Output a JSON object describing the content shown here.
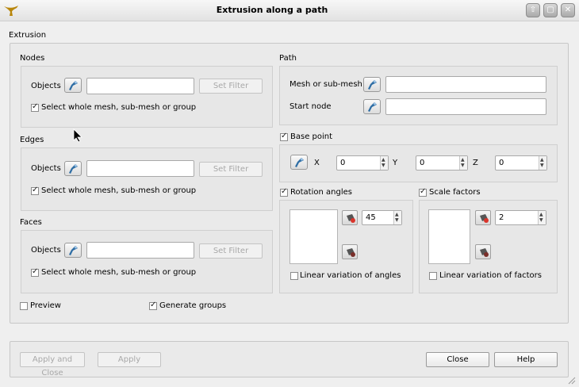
{
  "window": {
    "title": "Extrusion along a path",
    "controls": [
      "⇧",
      "▢",
      "✕"
    ]
  },
  "extrusion": {
    "label": "Extrusion",
    "nodes": {
      "title": "Nodes",
      "objects_label": "Objects",
      "objects_value": "",
      "set_filter_label": "Set Filter",
      "select_whole_label": "Select whole mesh, sub-mesh or group",
      "select_whole_checked": true
    },
    "edges": {
      "title": "Edges",
      "objects_label": "Objects",
      "objects_value": "",
      "set_filter_label": "Set Filter",
      "select_whole_label": "Select whole mesh, sub-mesh or group",
      "select_whole_checked": true
    },
    "faces": {
      "title": "Faces",
      "objects_label": "Objects",
      "objects_value": "",
      "set_filter_label": "Set Filter",
      "select_whole_label": "Select whole mesh, sub-mesh or group",
      "select_whole_checked": true
    },
    "path": {
      "title": "Path",
      "mesh_label": "Mesh or sub-mesh",
      "mesh_value": "",
      "start_node_label": "Start node",
      "start_node_value": ""
    },
    "base_point": {
      "title": "Base point",
      "checked": true,
      "x_label": "X",
      "x_value": "0",
      "y_label": "Y",
      "y_value": "0",
      "z_label": "Z",
      "z_value": "0"
    },
    "rotation": {
      "title": "Rotation angles",
      "checked": true,
      "value": "45",
      "linear_label": "Linear variation of angles",
      "linear_checked": false
    },
    "scale": {
      "title": "Scale factors",
      "checked": true,
      "value": "2",
      "linear_label": "Linear variation of factors",
      "linear_checked": false
    },
    "preview_label": "Preview",
    "preview_checked": false,
    "generate_groups_label": "Generate groups",
    "generate_groups_checked": true
  },
  "buttons": {
    "apply_close": "Apply and Close",
    "apply": "Apply",
    "close": "Close",
    "help": "Help"
  },
  "colors": {
    "background": "#efefef",
    "selection_icon": "#2e6da4"
  }
}
